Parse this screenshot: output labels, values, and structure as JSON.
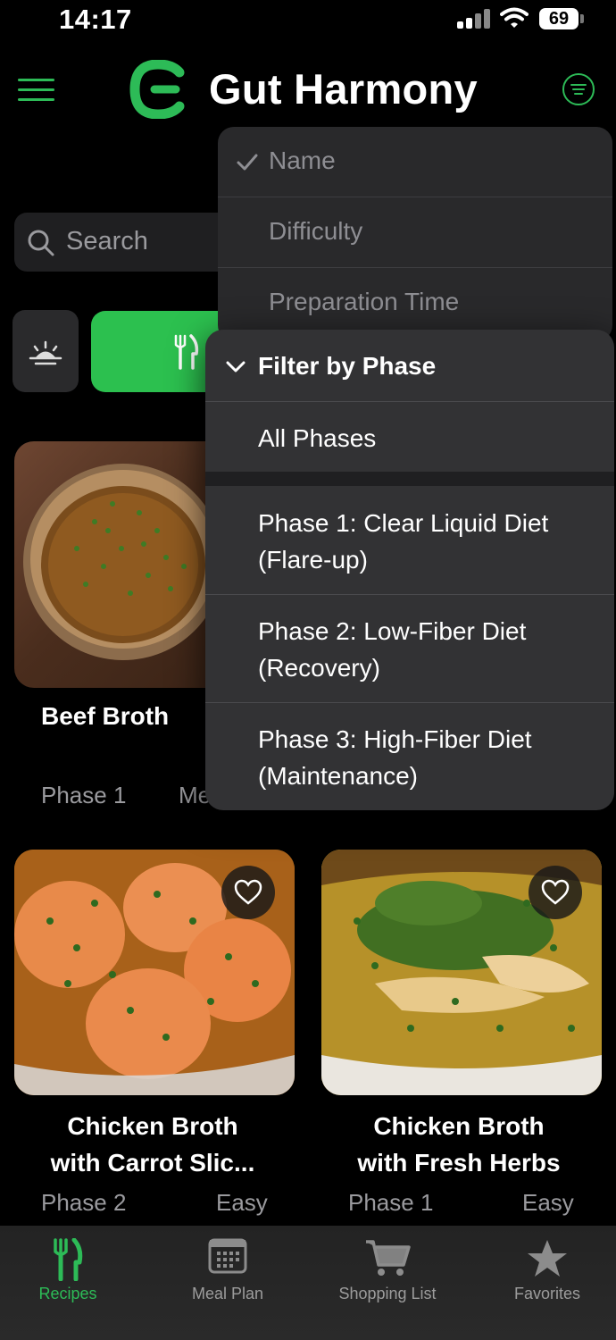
{
  "status_bar": {
    "time": "14:17",
    "battery": "69"
  },
  "header": {
    "app_title": "Gut Harmony"
  },
  "search": {
    "placeholder": "Search"
  },
  "sort_menu": {
    "items": [
      {
        "label": "Name",
        "checked": true
      },
      {
        "label": "Difficulty",
        "checked": false
      },
      {
        "label": "Preparation Time",
        "checked": false
      }
    ]
  },
  "phase_menu": {
    "header": "Filter by Phase",
    "items": [
      {
        "line1": "All Phases"
      },
      {
        "line1": "Phase 1: Clear Liquid Diet",
        "line2": "(Flare-up)"
      },
      {
        "line1": "Phase 2: Low-Fiber Diet",
        "line2": "(Recovery)"
      },
      {
        "line1": "Phase 3: High-Fiber Diet",
        "line2": "(Maintenance)"
      }
    ]
  },
  "recipes": [
    {
      "title": "Beef Broth",
      "phase": "Phase 1",
      "meta2": "Me"
    },
    {
      "title_line1": "Chicken Broth",
      "title_line2": "with Carrot Slic...",
      "phase": "Phase 2",
      "difficulty": "Easy"
    },
    {
      "title_line1": "Chicken Broth",
      "title_line2": "with Fresh Herbs",
      "phase": "Phase 1",
      "difficulty": "Easy"
    }
  ],
  "tab_bar": {
    "tabs": [
      {
        "label": "Recipes",
        "icon": "fork-knife-icon",
        "active": true
      },
      {
        "label": "Meal Plan",
        "icon": "calendar-icon",
        "active": false
      },
      {
        "label": "Shopping List",
        "icon": "cart-icon",
        "active": false
      },
      {
        "label": "Favorites",
        "icon": "star-icon",
        "active": false
      }
    ]
  },
  "colors": {
    "accent": "#2dbb57",
    "background": "#000000",
    "menu": "#323234"
  }
}
